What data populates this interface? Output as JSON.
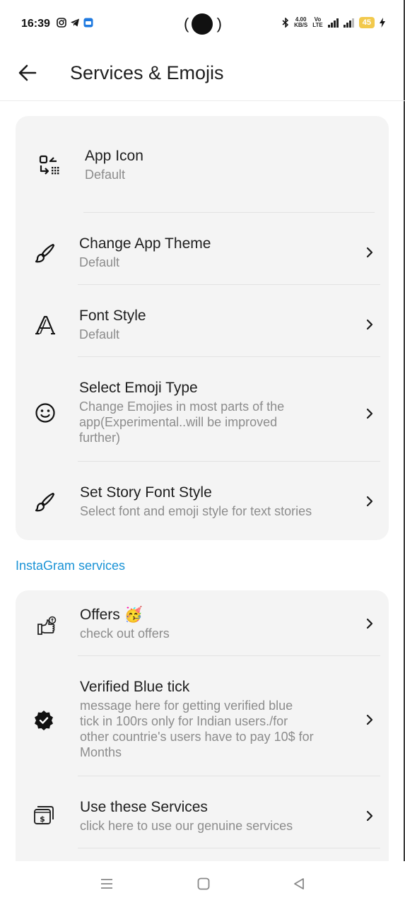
{
  "status_bar": {
    "time": "16:39",
    "net_speed_top": "4.00",
    "net_speed_bottom": "KB/S",
    "volte_top": "Vo",
    "volte_bottom": "LTE",
    "fiveg": "5G",
    "battery": "45"
  },
  "app_bar": {
    "back_icon": "arrow-left-icon",
    "title": "Services & Emojis"
  },
  "settings": [
    {
      "icon": "app-icon-swap-icon",
      "title": "App Icon",
      "subtitle": "Default"
    },
    {
      "icon": "brush-icon",
      "title": "Change App Theme",
      "subtitle": "Default"
    },
    {
      "icon": "font-icon",
      "title": "Font Style",
      "subtitle": "Default"
    },
    {
      "icon": "smiley-icon",
      "title": "Select Emoji Type",
      "subtitle_lines": [
        "Change Emojies in most parts of the",
        "app(Experimental..will be improved",
        "further)"
      ]
    },
    {
      "icon": "brush-icon",
      "title": "Set Story Font Style",
      "subtitle": "Select font and emoji style for text stories"
    }
  ],
  "instagram_section": {
    "title": "InstaGram services",
    "items": [
      {
        "icon": "offer-hand-icon",
        "title": "Offers 🥳",
        "subtitle": "check out offers"
      },
      {
        "icon": "verified-badge-icon",
        "title": "Verified Blue tick",
        "subtitle_lines": [
          "message here for getting verified blue",
          "tick in 100rs only for Indian users./for",
          "other countrie's users have to pay 10$ for",
          "Months"
        ]
      },
      {
        "icon": "money-cards-icon",
        "title": "Use these Services",
        "subtitle": "click here to use our genuine services"
      }
    ]
  },
  "colors": {
    "accent": "#1a93d6",
    "card": "#f4f4f4"
  },
  "nav": {
    "menu": "menu-icon",
    "home": "home-icon",
    "back": "back-triangle-icon"
  }
}
